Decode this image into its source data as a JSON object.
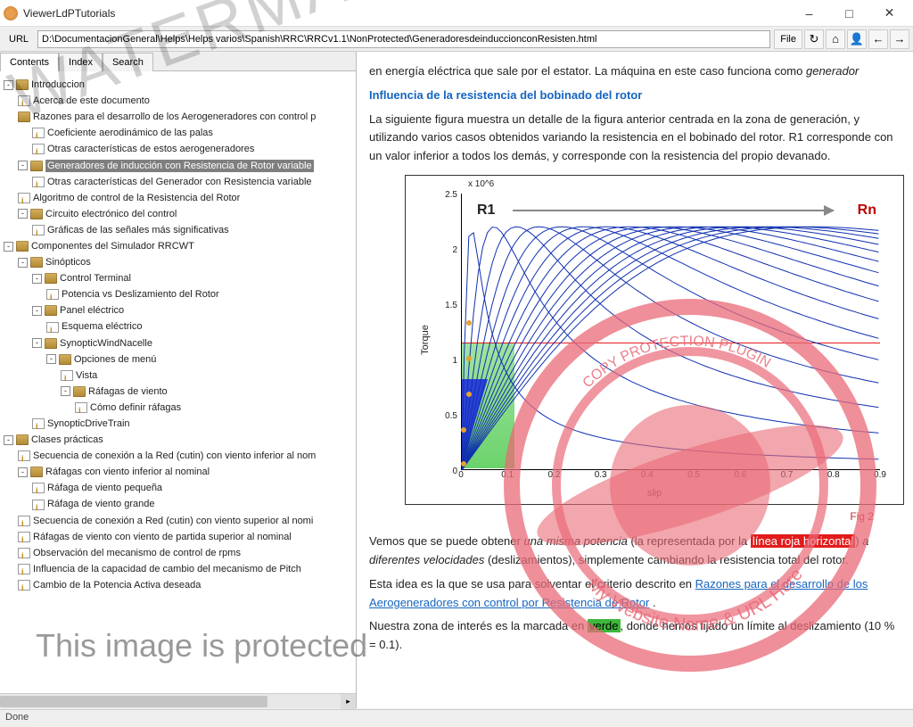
{
  "window": {
    "title": "ViewerLdPTutorials"
  },
  "urlbar": {
    "label": "URL",
    "value": "D:\\DocumentacionGeneral\\Helps\\Helps varios\\Spanish\\RRC\\RRCv1.1\\NonProtected\\GeneradoresdeinduccionconResisten.html",
    "file_btn": "File"
  },
  "tabs": {
    "contents": "Contents",
    "index": "Index",
    "search": "Search"
  },
  "tree": {
    "n0": "Introduccion",
    "n0_0": "Acerca de este documento",
    "n0_1": "Razones para el desarrollo de los Aerogeneradores con control p",
    "n0_1_0": "Coeficiente aerodinámico de las palas",
    "n0_1_1": "Otras características de estos aerogeneradores",
    "n0_2": "Generadores de inducción con Resistencia de Rotor variable",
    "n0_2_0": "Otras características del Generador con Resistencia variable",
    "n0_3": "Algoritmo de control de la Resistencia del Rotor",
    "n0_4": "Circuito electrónico del control",
    "n0_4_0": "Gráficas de las señales más significativas",
    "n1": "Componentes del Simulador RRCWT",
    "n1_0": "Sinópticos",
    "n1_0_0": "Control Terminal",
    "n1_0_0_0": "Potencia vs Deslizamiento del Rotor",
    "n1_0_1": "Panel eléctrico",
    "n1_0_1_0": "Esquema eléctrico",
    "n1_0_2": "SynopticWindNacelle",
    "n1_0_2_0": "Opciones de menú",
    "n1_0_2_0_0": "Vista",
    "n1_0_2_0_1": "Ráfagas de viento",
    "n1_0_2_0_1_0": "Cómo definir ráfagas",
    "n1_0_3": "SynopticDriveTrain",
    "n2": "Clases prácticas",
    "n2_0": "Secuencia de conexión a la Red (cutin) con viento inferior al nom",
    "n2_1": "Ráfagas con viento inferior al nominal",
    "n2_1_0": "Ráfaga de viento pequeña",
    "n2_1_1": "Ráfaga de viento grande",
    "n2_2": "Secuencia de conexión a Red (cutin) con viento superior al nomi",
    "n2_3": "Ráfagas de viento con viento de partida superior al nominal",
    "n2_4": "Observación del mecanismo de control de rpms",
    "n2_5": "Influencia de la capacidad de cambio del mecanismo de Pitch",
    "n2_6": "Cambio de la Potencia Activa deseada"
  },
  "content": {
    "intro_tail": "en energía eléctrica que sale por el estator. La máquina en este caso funciona como ",
    "intro_italic": "generador",
    "heading": "Influencia de la resistencia del bobinado del rotor",
    "p1": "La siguiente figura muestra un detalle de la figura anterior centrada en la zona de generación, y utilizando varios casos obtenidos variando la resistencia en el bobinado del rotor. R1 corresponde con un valor inferior a todos los demás, y corresponde con la resistencia del propio devanado.",
    "fig_caption": "Fig 2",
    "p2a": "Vemos que se puede obtener ",
    "p2b": "una misma potencia",
    "p2c": " (la representada por la ",
    "p2_red": "línea roja horizontal",
    "p2d": ") ",
    "p2e": "a diferentes velocidades",
    "p2f": " (deslizamientos), simplemente cambiando la resistencia total del rotor.",
    "p3a": "Esta idea es la que se usa para solventar el criterio descrito en ",
    "p3_link": "Razones para el desarrollo de los Aerogeneradores con control por Resistencia de Rotor",
    "p3b": " .",
    "p4a": "Nuestra zona de interés es la marcada en ",
    "p4_green": "verde",
    "p4b": ", donde hemos fijado un límite al deslizamiento (10 % = 0.1)."
  },
  "chart_data": {
    "type": "line",
    "title": "",
    "xlabel": "slip",
    "ylabel": "Torque",
    "y_exponent": "x 10^6",
    "xlim": [
      0,
      0.9
    ],
    "ylim": [
      0,
      2.5
    ],
    "xticks": [
      0,
      0.1,
      0.2,
      0.3,
      0.4,
      0.5,
      0.6,
      0.7,
      0.8,
      0.9
    ],
    "yticks": [
      0,
      0.5,
      1,
      1.5,
      2,
      2.5
    ],
    "annotation_left": "R1",
    "annotation_right": "Rn",
    "curve_count": 16,
    "peak_torque": 2.2,
    "peak_slip_range": [
      0.02,
      0.75
    ],
    "horizontal_marker_value": 1.4,
    "green_zone_slip": [
      0,
      0.1
    ],
    "note": "Family of torque-slip curves for increasing rotor resistance R1..Rn; each curve peaks near 2.2e6 at progressively larger slip values, then decays. Orange dots mark intersections with the red horizontal line on the R1 curve region."
  },
  "status": {
    "text": "Done"
  },
  "watermark": {
    "large": "WATERMARKED",
    "small": "This image is protected"
  }
}
